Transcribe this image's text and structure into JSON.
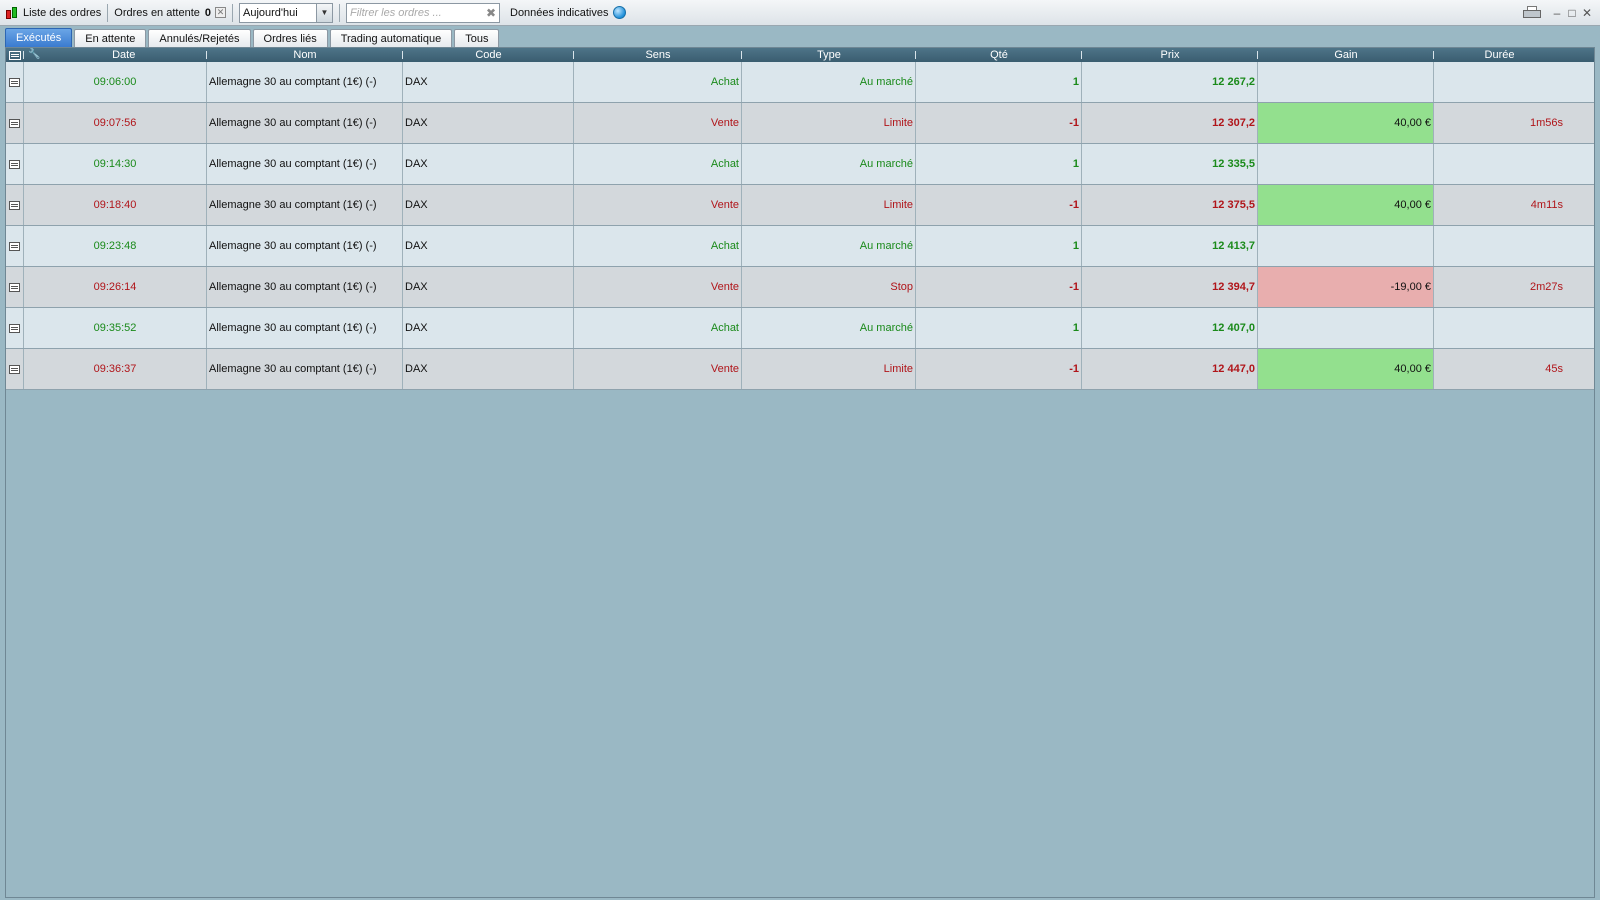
{
  "toolbar": {
    "title": "Liste des ordres",
    "pending_label": "Ordres en attente",
    "pending_count": "0",
    "period_selected": "Aujourd'hui",
    "filter_placeholder": "Filtrer les ordres ...",
    "indicative_label": "Données indicatives"
  },
  "tabs": [
    {
      "label": "Exécutés",
      "active": true
    },
    {
      "label": "En attente",
      "active": false
    },
    {
      "label": "Annulés/Rejetés",
      "active": false
    },
    {
      "label": "Ordres liés",
      "active": false
    },
    {
      "label": "Trading automatique",
      "active": false
    },
    {
      "label": "Tous",
      "active": false
    }
  ],
  "columns": [
    "Date",
    "Nom",
    "Code",
    "Sens",
    "Type",
    "Qté",
    "Prix",
    "Gain",
    "Durée"
  ],
  "colors": {
    "buy": "#1a8a1a",
    "sell": "#b0151a",
    "gain_positive_bg": "#93e08e",
    "gain_negative_bg": "#e8aeae",
    "active_tab": "#3a7bd0"
  },
  "rows": [
    {
      "date": "09:06:00",
      "nom": "Allemagne 30 au comptant (1€) (-)",
      "code": "DAX",
      "sens": "Achat",
      "type": "Au marché",
      "qte": "1",
      "prix": "12 267,2",
      "gain": "",
      "duree": ""
    },
    {
      "date": "09:07:56",
      "nom": "Allemagne 30 au comptant (1€) (-)",
      "code": "DAX",
      "sens": "Vente",
      "type": "Limite",
      "qte": "-1",
      "prix": "12 307,2",
      "gain": "40,00 €",
      "duree": "1m56s"
    },
    {
      "date": "09:14:30",
      "nom": "Allemagne 30 au comptant (1€) (-)",
      "code": "DAX",
      "sens": "Achat",
      "type": "Au marché",
      "qte": "1",
      "prix": "12 335,5",
      "gain": "",
      "duree": ""
    },
    {
      "date": "09:18:40",
      "nom": "Allemagne 30 au comptant (1€) (-)",
      "code": "DAX",
      "sens": "Vente",
      "type": "Limite",
      "qte": "-1",
      "prix": "12 375,5",
      "gain": "40,00 €",
      "duree": "4m11s"
    },
    {
      "date": "09:23:48",
      "nom": "Allemagne 30 au comptant (1€) (-)",
      "code": "DAX",
      "sens": "Achat",
      "type": "Au marché",
      "qte": "1",
      "prix": "12 413,7",
      "gain": "",
      "duree": ""
    },
    {
      "date": "09:26:14",
      "nom": "Allemagne 30 au comptant (1€) (-)",
      "code": "DAX",
      "sens": "Vente",
      "type": "Stop",
      "qte": "-1",
      "prix": "12 394,7",
      "gain": "-19,00 €",
      "duree": "2m27s"
    },
    {
      "date": "09:35:52",
      "nom": "Allemagne 30 au comptant (1€) (-)",
      "code": "DAX",
      "sens": "Achat",
      "type": "Au marché",
      "qte": "1",
      "prix": "12 407,0",
      "gain": "",
      "duree": ""
    },
    {
      "date": "09:36:37",
      "nom": "Allemagne 30 au comptant (1€) (-)",
      "code": "DAX",
      "sens": "Vente",
      "type": "Limite",
      "qte": "-1",
      "prix": "12 447,0",
      "gain": "40,00 €",
      "duree": "45s"
    }
  ]
}
